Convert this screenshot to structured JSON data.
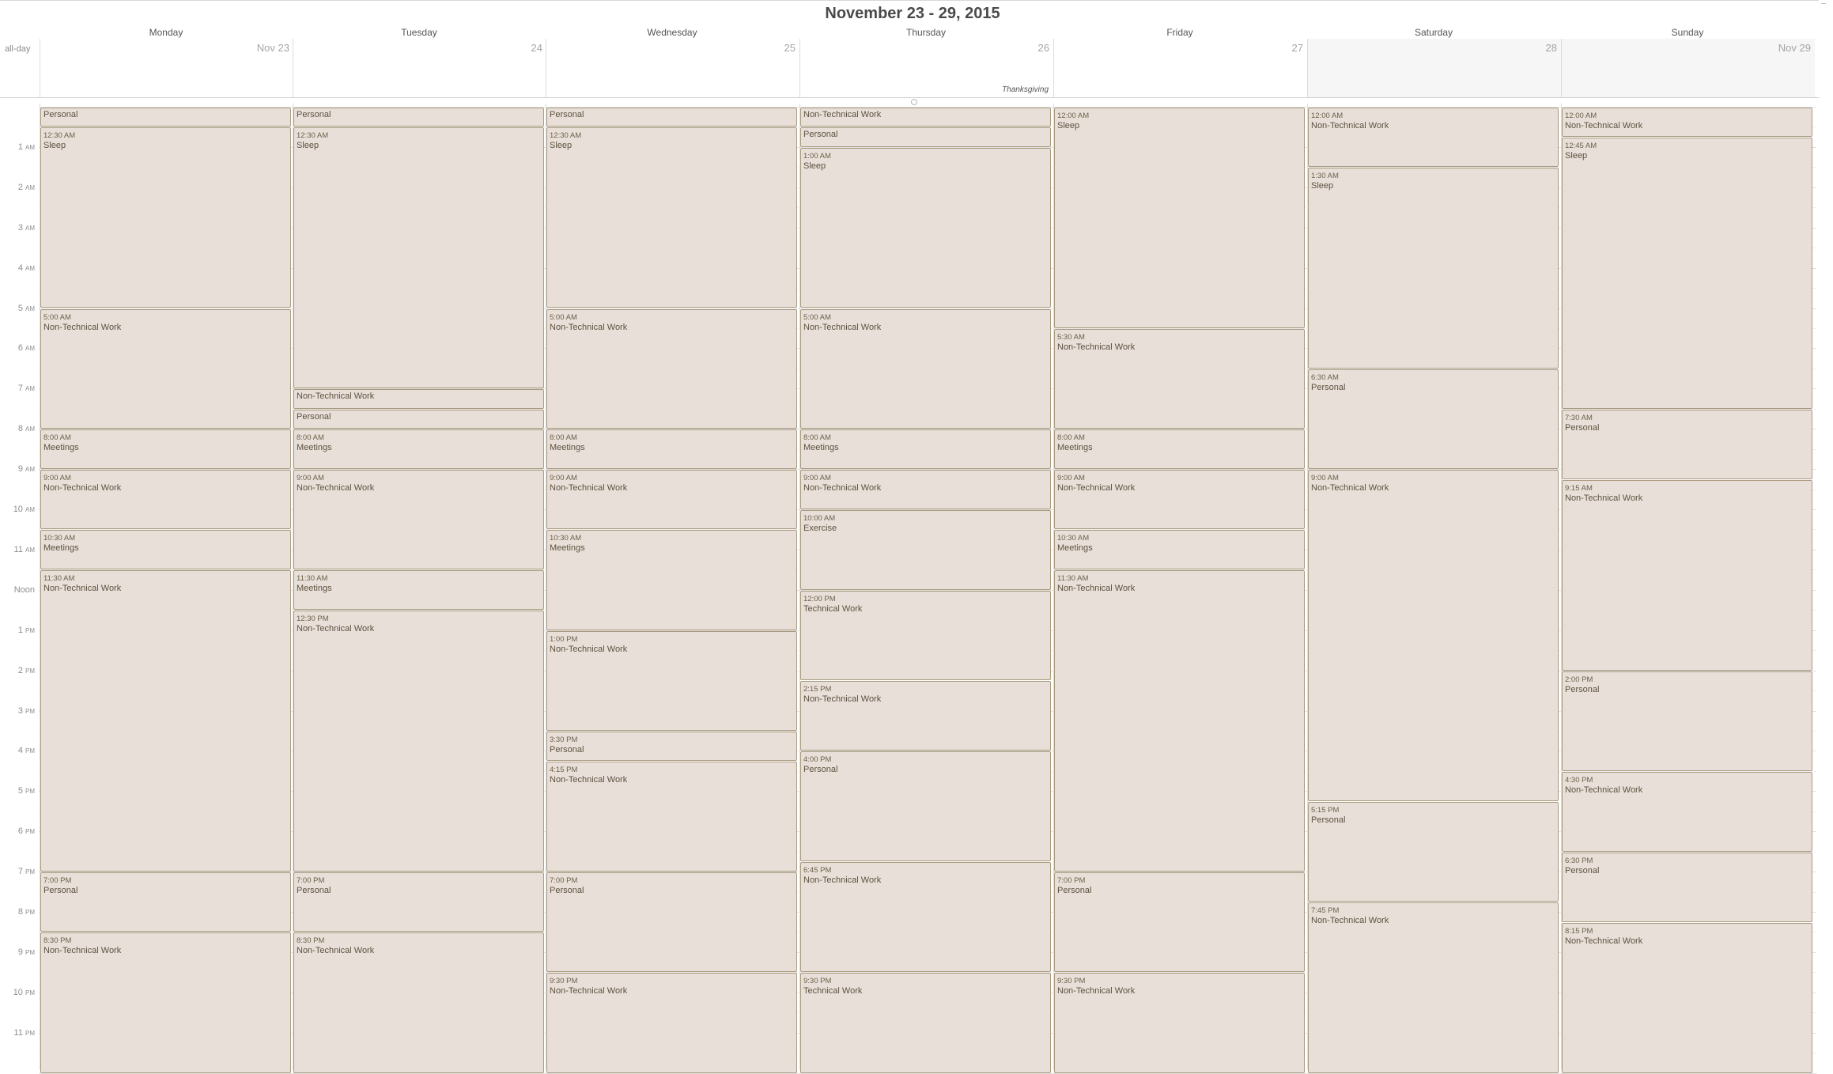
{
  "title": "November 23 - 29, 2015",
  "allday_label": "all-day",
  "days": [
    {
      "name": "Monday",
      "date": "Nov 23",
      "weekend": false,
      "holiday": ""
    },
    {
      "name": "Tuesday",
      "date": "24",
      "weekend": false,
      "holiday": ""
    },
    {
      "name": "Wednesday",
      "date": "25",
      "weekend": false,
      "holiday": ""
    },
    {
      "name": "Thursday",
      "date": "26",
      "weekend": false,
      "holiday": "Thanksgiving"
    },
    {
      "name": "Friday",
      "date": "27",
      "weekend": false,
      "holiday": ""
    },
    {
      "name": "Saturday",
      "date": "28",
      "weekend": true,
      "holiday": ""
    },
    {
      "name": "Sunday",
      "date": "Nov 29",
      "weekend": true,
      "holiday": ""
    }
  ],
  "hours": [
    {
      "num": "1",
      "ap": "AM"
    },
    {
      "num": "2",
      "ap": "AM"
    },
    {
      "num": "3",
      "ap": "AM"
    },
    {
      "num": "4",
      "ap": "AM"
    },
    {
      "num": "5",
      "ap": "AM"
    },
    {
      "num": "6",
      "ap": "AM"
    },
    {
      "num": "7",
      "ap": "AM"
    },
    {
      "num": "8",
      "ap": "AM"
    },
    {
      "num": "9",
      "ap": "AM"
    },
    {
      "num": "10",
      "ap": "AM"
    },
    {
      "num": "11",
      "ap": "AM"
    },
    {
      "num": "Noon",
      "ap": ""
    },
    {
      "num": "1",
      "ap": "PM"
    },
    {
      "num": "2",
      "ap": "PM"
    },
    {
      "num": "3",
      "ap": "PM"
    },
    {
      "num": "4",
      "ap": "PM"
    },
    {
      "num": "5",
      "ap": "PM"
    },
    {
      "num": "6",
      "ap": "PM"
    },
    {
      "num": "7",
      "ap": "PM"
    },
    {
      "num": "8",
      "ap": "PM"
    },
    {
      "num": "9",
      "ap": "PM"
    },
    {
      "num": "10",
      "ap": "PM"
    },
    {
      "num": "11",
      "ap": "PM"
    }
  ],
  "colors": {
    "event_fill": "#e8e0d8",
    "event_border": "#a99a7f",
    "event_text": "#5e5040"
  },
  "events": [
    {
      "day": 0,
      "start": 0,
      "end": 0.5,
      "time": "",
      "title": "Personal"
    },
    {
      "day": 0,
      "start": 0.5,
      "end": 5,
      "time": "12:30 AM",
      "title": "Sleep"
    },
    {
      "day": 0,
      "start": 5,
      "end": 8,
      "time": "5:00 AM",
      "title": "Non-Technical Work"
    },
    {
      "day": 0,
      "start": 8,
      "end": 9,
      "time": "8:00 AM",
      "title": "Meetings"
    },
    {
      "day": 0,
      "start": 9,
      "end": 10.5,
      "time": "9:00 AM",
      "title": "Non-Technical Work"
    },
    {
      "day": 0,
      "start": 10.5,
      "end": 11.5,
      "time": "10:30 AM",
      "title": "Meetings"
    },
    {
      "day": 0,
      "start": 11.5,
      "end": 19,
      "time": "11:30 AM",
      "title": "Non-Technical Work"
    },
    {
      "day": 0,
      "start": 19,
      "end": 20.5,
      "time": "7:00 PM",
      "title": "Personal"
    },
    {
      "day": 0,
      "start": 20.5,
      "end": 24,
      "time": "8:30 PM",
      "title": "Non-Technical Work"
    },
    {
      "day": 1,
      "start": 0,
      "end": 0.5,
      "time": "",
      "title": "Personal"
    },
    {
      "day": 1,
      "start": 0.5,
      "end": 7,
      "time": "12:30 AM",
      "title": "Sleep"
    },
    {
      "day": 1,
      "start": 7,
      "end": 7.5,
      "time": "",
      "title": "Non-Technical Work"
    },
    {
      "day": 1,
      "start": 7.5,
      "end": 8,
      "time": "",
      "title": "Personal"
    },
    {
      "day": 1,
      "start": 8,
      "end": 9,
      "time": "8:00 AM",
      "title": "Meetings"
    },
    {
      "day": 1,
      "start": 9,
      "end": 11.5,
      "time": "9:00 AM",
      "title": "Non-Technical Work"
    },
    {
      "day": 1,
      "start": 11.5,
      "end": 12.5,
      "time": "11:30 AM",
      "title": "Meetings"
    },
    {
      "day": 1,
      "start": 12.5,
      "end": 19,
      "time": "12:30 PM",
      "title": "Non-Technical Work"
    },
    {
      "day": 1,
      "start": 19,
      "end": 20.5,
      "time": "7:00 PM",
      "title": "Personal"
    },
    {
      "day": 1,
      "start": 20.5,
      "end": 24,
      "time": "8:30 PM",
      "title": "Non-Technical Work"
    },
    {
      "day": 2,
      "start": 0,
      "end": 0.5,
      "time": "",
      "title": "Personal"
    },
    {
      "day": 2,
      "start": 0.5,
      "end": 5,
      "time": "12:30 AM",
      "title": "Sleep"
    },
    {
      "day": 2,
      "start": 5,
      "end": 8,
      "time": "5:00 AM",
      "title": "Non-Technical Work"
    },
    {
      "day": 2,
      "start": 8,
      "end": 9,
      "time": "8:00 AM",
      "title": "Meetings"
    },
    {
      "day": 2,
      "start": 9,
      "end": 10.5,
      "time": "9:00 AM",
      "title": "Non-Technical Work"
    },
    {
      "day": 2,
      "start": 10.5,
      "end": 13,
      "time": "10:30 AM",
      "title": "Meetings"
    },
    {
      "day": 2,
      "start": 13,
      "end": 15.5,
      "time": "1:00 PM",
      "title": "Non-Technical Work"
    },
    {
      "day": 2,
      "start": 15.5,
      "end": 16.25,
      "time": "3:30 PM",
      "title": "Personal"
    },
    {
      "day": 2,
      "start": 16.25,
      "end": 19,
      "time": "4:15 PM",
      "title": "Non-Technical Work"
    },
    {
      "day": 2,
      "start": 19,
      "end": 21.5,
      "time": "7:00 PM",
      "title": "Personal"
    },
    {
      "day": 2,
      "start": 21.5,
      "end": 24,
      "time": "9:30 PM",
      "title": "Non-Technical Work"
    },
    {
      "day": 3,
      "start": 0,
      "end": 0.5,
      "time": "",
      "title": "Non-Technical Work"
    },
    {
      "day": 3,
      "start": 0.5,
      "end": 1,
      "time": "",
      "title": "Personal"
    },
    {
      "day": 3,
      "start": 1,
      "end": 5,
      "time": "1:00 AM",
      "title": "Sleep"
    },
    {
      "day": 3,
      "start": 5,
      "end": 8,
      "time": "5:00 AM",
      "title": "Non-Technical Work"
    },
    {
      "day": 3,
      "start": 8,
      "end": 9,
      "time": "8:00 AM",
      "title": "Meetings"
    },
    {
      "day": 3,
      "start": 9,
      "end": 10,
      "time": "9:00 AM",
      "title": "Non-Technical Work"
    },
    {
      "day": 3,
      "start": 10,
      "end": 12,
      "time": "10:00 AM",
      "title": "Exercise"
    },
    {
      "day": 3,
      "start": 12,
      "end": 14.25,
      "time": "12:00 PM",
      "title": "Technical Work"
    },
    {
      "day": 3,
      "start": 14.25,
      "end": 16,
      "time": "2:15 PM",
      "title": "Non-Technical Work"
    },
    {
      "day": 3,
      "start": 16,
      "end": 18.75,
      "time": "4:00 PM",
      "title": "Personal"
    },
    {
      "day": 3,
      "start": 18.75,
      "end": 21.5,
      "time": "6:45 PM",
      "title": "Non-Technical Work"
    },
    {
      "day": 3,
      "start": 21.5,
      "end": 24,
      "time": "9:30 PM",
      "title": "Technical Work"
    },
    {
      "day": 4,
      "start": 0,
      "end": 5.5,
      "time": "12:00 AM",
      "title": "Sleep"
    },
    {
      "day": 4,
      "start": 5.5,
      "end": 8,
      "time": "5:30 AM",
      "title": "Non-Technical Work"
    },
    {
      "day": 4,
      "start": 8,
      "end": 9,
      "time": "8:00 AM",
      "title": "Meetings"
    },
    {
      "day": 4,
      "start": 9,
      "end": 10.5,
      "time": "9:00 AM",
      "title": "Non-Technical Work"
    },
    {
      "day": 4,
      "start": 10.5,
      "end": 11.5,
      "time": "10:30 AM",
      "title": "Meetings"
    },
    {
      "day": 4,
      "start": 11.5,
      "end": 19,
      "time": "11:30 AM",
      "title": "Non-Technical Work"
    },
    {
      "day": 4,
      "start": 19,
      "end": 21.5,
      "time": "7:00 PM",
      "title": "Personal"
    },
    {
      "day": 4,
      "start": 21.5,
      "end": 24,
      "time": "9:30 PM",
      "title": "Non-Technical Work"
    },
    {
      "day": 5,
      "start": 0,
      "end": 1.5,
      "time": "12:00 AM",
      "title": "Non-Technical Work"
    },
    {
      "day": 5,
      "start": 1.5,
      "end": 6.5,
      "time": "1:30 AM",
      "title": "Sleep"
    },
    {
      "day": 5,
      "start": 6.5,
      "end": 9,
      "time": "6:30 AM",
      "title": "Personal"
    },
    {
      "day": 5,
      "start": 9,
      "end": 17.25,
      "time": "9:00 AM",
      "title": "Non-Technical Work"
    },
    {
      "day": 5,
      "start": 17.25,
      "end": 19.75,
      "time": "5:15 PM",
      "title": "Personal"
    },
    {
      "day": 5,
      "start": 19.75,
      "end": 24,
      "time": "7:45 PM",
      "title": "Non-Technical Work"
    },
    {
      "day": 6,
      "start": 0,
      "end": 0.75,
      "time": "12:00 AM",
      "title": "Non-Technical Work"
    },
    {
      "day": 6,
      "start": 0.75,
      "end": 7.5,
      "time": "12:45 AM",
      "title": "Sleep"
    },
    {
      "day": 6,
      "start": 7.5,
      "end": 9.25,
      "time": "7:30 AM",
      "title": "Personal"
    },
    {
      "day": 6,
      "start": 9.25,
      "end": 14,
      "time": "9:15 AM",
      "title": "Non-Technical Work"
    },
    {
      "day": 6,
      "start": 14,
      "end": 16.5,
      "time": "2:00 PM",
      "title": "Personal"
    },
    {
      "day": 6,
      "start": 16.5,
      "end": 18.5,
      "time": "4:30 PM",
      "title": "Non-Technical Work"
    },
    {
      "day": 6,
      "start": 18.5,
      "end": 20.25,
      "time": "6:30 PM",
      "title": "Personal"
    },
    {
      "day": 6,
      "start": 20.25,
      "end": 24,
      "time": "8:15 PM",
      "title": "Non-Technical Work"
    }
  ]
}
